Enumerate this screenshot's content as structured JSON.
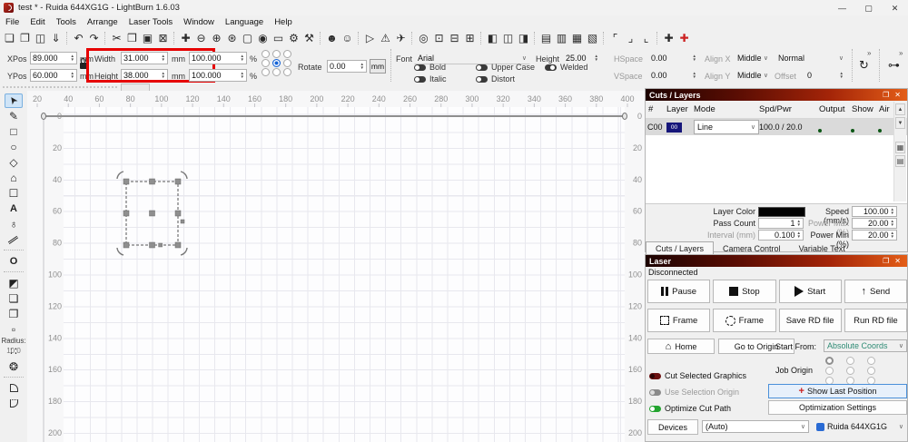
{
  "window": {
    "title": "test * - Ruida 644XG1G - LightBurn 1.6.03",
    "minimize_glyph": "—",
    "maximize_glyph": "▢",
    "close_glyph": "✕"
  },
  "menu": {
    "items": [
      "File",
      "Edit",
      "Tools",
      "Arrange",
      "Laser Tools",
      "Window",
      "Language",
      "Help"
    ]
  },
  "toolbar": {
    "groups": [
      [
        {
          "name": "new-file-icon",
          "glyph": "❏"
        },
        {
          "name": "open-file-icon",
          "glyph": "❐"
        },
        {
          "name": "save-file-icon",
          "glyph": "◫"
        },
        {
          "name": "import-icon",
          "glyph": "⇓"
        }
      ],
      [
        {
          "name": "undo-icon",
          "glyph": "↶"
        },
        {
          "name": "redo-icon",
          "glyph": "↷"
        }
      ],
      [
        {
          "name": "cut-icon",
          "glyph": "✂"
        },
        {
          "name": "copy-icon",
          "glyph": "❒"
        },
        {
          "name": "paste-icon",
          "glyph": "▣"
        },
        {
          "name": "delete-icon",
          "glyph": "⊠"
        }
      ],
      [
        {
          "name": "pan-icon",
          "glyph": "✚"
        },
        {
          "name": "zoom-out-icon",
          "glyph": "⊖"
        },
        {
          "name": "zoom-in-icon",
          "glyph": "⊕"
        },
        {
          "name": "zoom-to-frame-icon",
          "glyph": "⊛"
        },
        {
          "name": "frame-selection-icon",
          "glyph": "▢"
        },
        {
          "name": "camera-icon",
          "glyph": "◉"
        },
        {
          "name": "preview-window-icon",
          "glyph": "▭"
        },
        {
          "name": "settings-gear-icon",
          "glyph": "⚙"
        },
        {
          "name": "device-settings-icon",
          "glyph": "⚒"
        }
      ],
      [
        {
          "name": "users-icon",
          "glyph": "☻"
        },
        {
          "name": "user-icon",
          "glyph": "☺"
        }
      ],
      [
        {
          "name": "preview-play-icon",
          "glyph": "▷"
        },
        {
          "name": "warning-icon",
          "glyph": "⚠"
        },
        {
          "name": "send-icon",
          "glyph": "✈"
        }
      ],
      [
        {
          "name": "origin-icon",
          "glyph": "◎"
        },
        {
          "name": "library-icon",
          "glyph": "⊡"
        },
        {
          "name": "machine-icon",
          "glyph": "⊟"
        },
        {
          "name": "print-icon",
          "glyph": "⊞"
        }
      ],
      [
        {
          "name": "align-left-icon",
          "glyph": "◧"
        },
        {
          "name": "align-center-icon",
          "glyph": "◫"
        },
        {
          "name": "align-right-icon",
          "glyph": "◨"
        }
      ],
      [
        {
          "name": "distribute-h-icon",
          "glyph": "▤"
        },
        {
          "name": "distribute-v-icon",
          "glyph": "▥"
        },
        {
          "name": "space-h-icon",
          "glyph": "▦"
        },
        {
          "name": "space-v-icon",
          "glyph": "▧"
        }
      ],
      [
        {
          "name": "frame-corner-tl-icon",
          "glyph": "⌜"
        },
        {
          "name": "frame-corner-br-icon",
          "glyph": "⌟"
        },
        {
          "name": "frame-corner-bl-icon",
          "glyph": "⌞"
        }
      ],
      [
        {
          "name": "jog-position-icon",
          "glyph": "✚"
        },
        {
          "name": "move-laser-to-position-icon",
          "glyph": "✚",
          "red": true
        }
      ]
    ]
  },
  "transform": {
    "xpos_label": "XPos",
    "xpos_value": "89.000",
    "ypos_label": "YPos",
    "ypos_value": "60.000",
    "width_label": "Width",
    "width_value": "31.000",
    "height_label": "Height",
    "height_value": "38.000",
    "scale_x_value": "100.000",
    "scale_y_value": "100.000",
    "unit_mm": "mm",
    "unit_percent": "%",
    "rotate_label": "Rotate",
    "rotate_value": "0.00"
  },
  "text_opts": {
    "font_label": "Font",
    "font_value": "Arial",
    "height_label": "Height",
    "height_value": "25.00",
    "bold": "Bold",
    "italic": "Italic",
    "upper": "Upper Case",
    "distort": "Distort",
    "welded": "Welded",
    "hspace_label": "HSpace",
    "hspace_value": "0.00",
    "vspace_label": "VSpace",
    "vspace_value": "0.00",
    "alignx_label": "Align X",
    "alignx_value": "Middle",
    "aligny_label": "Align Y",
    "aligny_value": "Middle",
    "style_value": "Normal",
    "offset_label": "Offset",
    "offset_value": "0",
    "overflow_glyph": "»"
  },
  "left_toolbar": {
    "radius_label": "Radius:",
    "radius_value": "10.0",
    "tools": [
      {
        "name": "select-tool",
        "glyph": "➤",
        "cls": "sel-arrow",
        "selected": true
      },
      {
        "name": "draw-lines-tool",
        "glyph": "✎"
      },
      {
        "name": "rectangle-tool",
        "glyph": "□"
      },
      {
        "name": "ellipse-tool",
        "glyph": "○"
      },
      {
        "name": "polygon-tool",
        "glyph": "◇"
      },
      {
        "name": "edit-nodes-tool",
        "glyph": "⌂"
      },
      {
        "name": "edit-shape-tool",
        "glyph": "☐"
      },
      {
        "name": "text-tool",
        "glyph": "A",
        "cls": "boldA"
      },
      {
        "name": "position-laser-tool",
        "glyph": "♁"
      },
      {
        "name": "measure-tool",
        "glyph": "∥",
        "cls": "rot45"
      },
      {
        "sep": true
      },
      {
        "name": "offset-shapes-tool",
        "glyph": "O",
        "cls": "boldA"
      },
      {
        "sep": true
      },
      {
        "name": "weld-tool",
        "glyph": "◩"
      },
      {
        "name": "boolean-union-tool",
        "glyph": "❏"
      },
      {
        "name": "boolean-subtract-tool",
        "glyph": "❐"
      },
      {
        "name": "boolean-intersect-tool",
        "glyph": "▫"
      },
      {
        "sep": true
      },
      {
        "name": "grid-array-tool",
        "glyph": "∷"
      },
      {
        "name": "circular-array-tool",
        "glyph": "❂"
      },
      {
        "sep": true
      },
      {
        "name": "fillet-tool",
        "shape": "f1"
      },
      {
        "name": "corner-tool",
        "shape": "f2"
      }
    ]
  },
  "canvas": {
    "h_ticks": [
      20,
      40,
      60,
      80,
      100,
      120,
      140,
      160,
      180,
      200,
      220,
      240,
      260,
      280,
      300,
      320,
      340,
      360,
      380,
      400
    ],
    "v_ticks": [
      0,
      20,
      40,
      60,
      80,
      100,
      120,
      140,
      160,
      180,
      200
    ],
    "origin_label": "0"
  },
  "cuts": {
    "title": "Cuts / Layers",
    "columns": [
      "#",
      "Layer",
      "Mode",
      "Spd/Pwr",
      "Output",
      "Show",
      "Air"
    ],
    "row": {
      "id": "C00",
      "swatch_label": "00",
      "mode": "Line",
      "spd_pwr": "100.0 / 20.0"
    },
    "layer_color_label": "Layer Color",
    "speed_label": "Speed (mm/s)",
    "speed_value": "100.00",
    "pass_label": "Pass Count",
    "pass_value": "1",
    "pmax_label": "Power Max (%)",
    "pmax_value": "20.00",
    "interval_label": "Interval (mm)",
    "interval_value": "0.100",
    "pmin_label": "Power Min (%)",
    "pmin_value": "20.00",
    "tabs": [
      "Cuts / Layers",
      "Camera Control",
      "Variable Text"
    ]
  },
  "laser": {
    "title": "Laser",
    "status": "Disconnected",
    "pause": "Pause",
    "stop": "Stop",
    "start": "Start",
    "send": "Send",
    "frame_rect": "Frame",
    "frame_circle": "Frame",
    "save_rd": "Save RD file",
    "run_rd": "Run RD file",
    "home": "Home",
    "goto_origin": "Go to Origin",
    "start_from_label": "Start From:",
    "start_from_value": "Absolute Coords",
    "job_origin_label": "Job Origin",
    "cut_selected": "Cut Selected Graphics",
    "use_sel_origin": "Use Selection Origin",
    "optimize": "Optimize Cut Path",
    "show_last": "Show Last Position",
    "opt_settings": "Optimization Settings",
    "devices": "Devices",
    "port": "(Auto)",
    "device": "Ruida 644XG1G"
  },
  "icons": {
    "home": "⌂",
    "send_arrow": "↑",
    "crosshair": "+",
    "rotate": "↻",
    "kern": "⊶",
    "scroll_up": "▲",
    "scroll_down": "▼",
    "palette": "▦",
    "library": "▤",
    "float_panel": "❐",
    "close_panel": "✕",
    "dropdown": "∨"
  },
  "colors": {
    "panel_grad_a": "#1c0301",
    "panel_grad_b": "#e35d17",
    "highlight_red": "#e60000",
    "toggle_green": "#23a42f",
    "layer_swatch": "#16167a",
    "device_icon_blue": "#2a6bd4",
    "start_from_text": "#2e8b74",
    "selection_highlight": "#cfe4f7"
  }
}
